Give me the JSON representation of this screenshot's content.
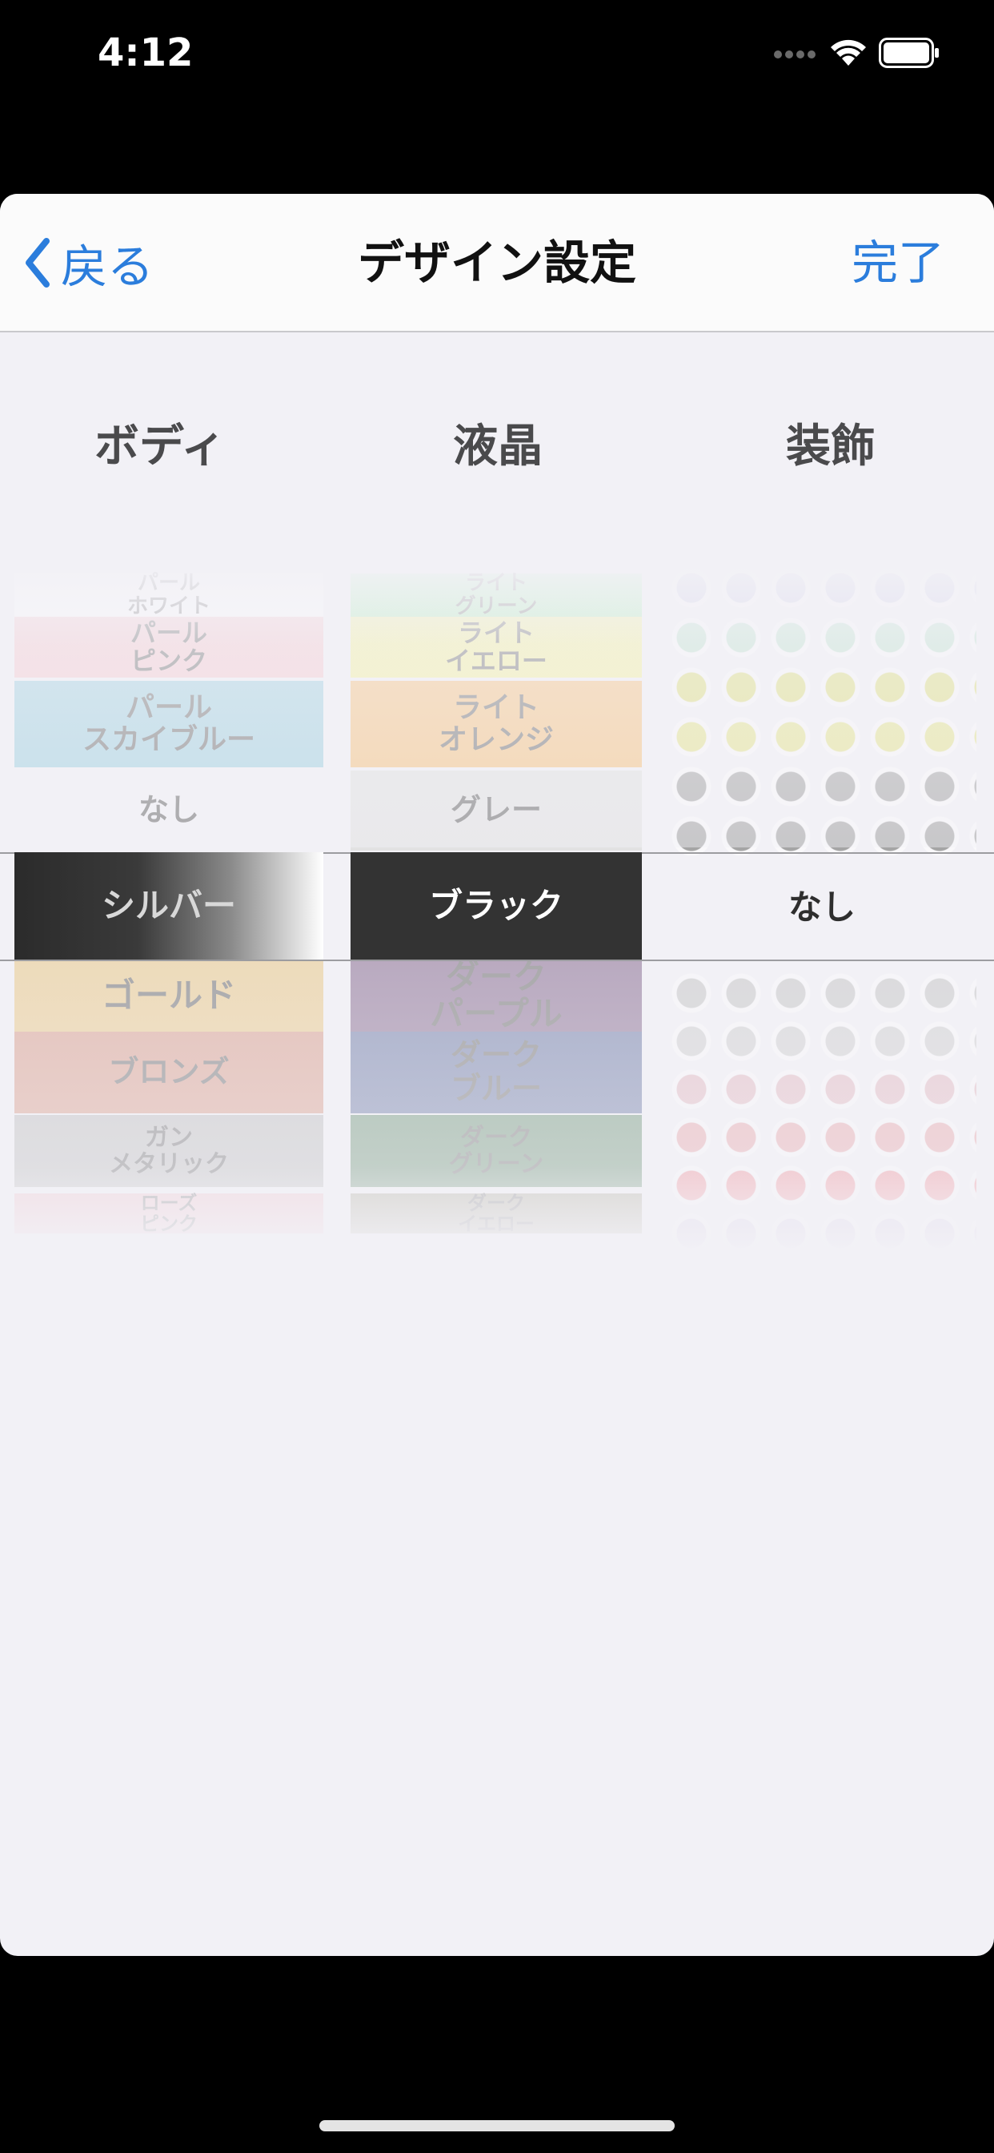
{
  "status_bar": {
    "time": "4:12"
  },
  "nav": {
    "back_label": "戻る",
    "title": "デザイン設定",
    "done_label": "完了"
  },
  "columns": {
    "body_header": "ボディ",
    "lcd_header": "液晶",
    "deco_header": "装飾"
  },
  "body_picker": {
    "items": [
      {
        "label": "パール\nホワイト",
        "color": "#ffffff"
      },
      {
        "label": "パール\nピンク",
        "color": "#f6c9cf"
      },
      {
        "label": "パール\nスカイブルー",
        "color": "#9fd0e0"
      },
      {
        "label": "なし",
        "color": "#f2f1f6"
      },
      {
        "label": "シルバー",
        "color": "#2e2e2e"
      },
      {
        "label": "ゴールド",
        "color": "#e9c98a"
      },
      {
        "label": "ブロンズ",
        "color": "#d99c8a"
      },
      {
        "label": "ガン\nメタリック",
        "color": "#bdbdbd"
      },
      {
        "label": "ローズ\nピンク",
        "color": "#f2c0c8"
      }
    ],
    "selected": "シルバー"
  },
  "lcd_picker": {
    "items": [
      {
        "label": "ライト\nグリーン",
        "color": "#a9efb3"
      },
      {
        "label": "ライト\nイエロー",
        "color": "#f4f29a"
      },
      {
        "label": "ライト\nオレンジ",
        "color": "#f7c27e"
      },
      {
        "label": "グレー",
        "color": "#e2e2e2"
      },
      {
        "label": "ブラック",
        "color": "#333333"
      },
      {
        "label": "ダーク\nパープル",
        "color": "#8a6f93"
      },
      {
        "label": "ダーク\nブルー",
        "color": "#6d7aa6"
      },
      {
        "label": "ダーク\nグリーン",
        "color": "#6b9275"
      },
      {
        "label": "ダーク\nイエロー",
        "color": "#a7a48f"
      }
    ],
    "selected": "ブラック"
  },
  "deco_picker": {
    "selected_label": "なし",
    "gem_rows_above": [
      "#c7c7e6",
      "#bfe3cf",
      "#dede7a",
      "#e4e48a",
      "#a5a5a5",
      "#a5a5a5"
    ],
    "gem_rows_below": [
      "#c7c7c7",
      "#cfcfcf",
      "#e2b8c0",
      "#e8a4a8",
      "#f08c94",
      "#d4c8e4"
    ]
  }
}
